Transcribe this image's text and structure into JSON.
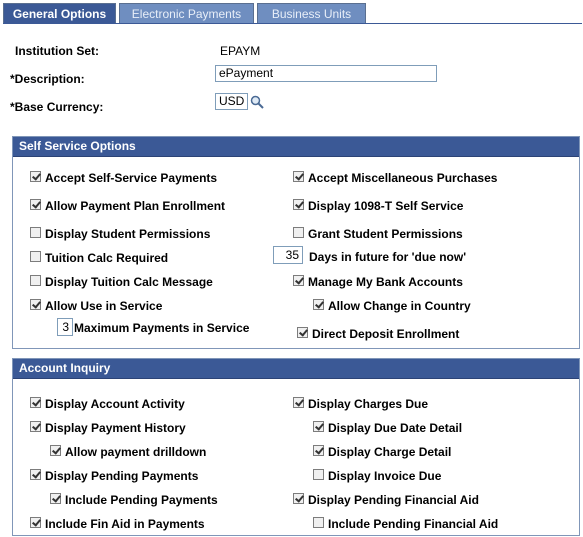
{
  "tabs": [
    {
      "label": "General Options",
      "active": true
    },
    {
      "label": "Electronic Payments",
      "active": false
    },
    {
      "label": "Business Units",
      "active": false
    }
  ],
  "header": {
    "institution_set_label": "Institution Set:",
    "institution_set_value": "EPAYM",
    "description_label": "*Description:",
    "description_value": "ePayment",
    "base_currency_label": "*Base Currency:",
    "base_currency_value": "USD",
    "lookup_icon": "magnifier-icon"
  },
  "self_service": {
    "title": "Self Service Options",
    "left": [
      {
        "label": "Accept Self-Service Payments",
        "checked": true
      },
      {
        "label": "Allow Payment Plan Enrollment",
        "checked": true
      },
      {
        "label": "Display Student Permissions",
        "checked": false
      },
      {
        "label": "Tuition Calc Required",
        "checked": false
      },
      {
        "label": "Display Tuition Calc Message",
        "checked": false
      },
      {
        "label": "Allow Use in Service",
        "checked": true
      }
    ],
    "max_payments_value": "3",
    "max_payments_label": "Maximum Payments in Service",
    "right": [
      {
        "label": "Accept Miscellaneous Purchases",
        "checked": true
      },
      {
        "label": "Display 1098-T Self Service",
        "checked": true
      },
      {
        "label": "Grant Student Permissions",
        "checked": false
      }
    ],
    "days_future_value": "35",
    "days_future_label": "Days in future for 'due now'",
    "manage_bank": {
      "label": "Manage My Bank Accounts",
      "checked": true
    },
    "allow_change_country": {
      "label": "Allow Change in Country",
      "checked": true
    },
    "direct_deposit": {
      "label": "Direct Deposit Enrollment",
      "checked": true
    }
  },
  "account_inquiry": {
    "title": "Account Inquiry",
    "display_account_activity": {
      "label": "Display Account Activity",
      "checked": true
    },
    "display_payment_history": {
      "label": "Display Payment History",
      "checked": true
    },
    "allow_payment_drilldown": {
      "label": "Allow payment drilldown",
      "checked": true
    },
    "display_pending_payments": {
      "label": "Display Pending Payments",
      "checked": true
    },
    "include_pending_payments": {
      "label": "Include Pending Payments",
      "checked": true
    },
    "include_fin_aid": {
      "label": "Include Fin Aid in Payments",
      "checked": true
    },
    "display_charges_due": {
      "label": "Display Charges Due",
      "checked": true
    },
    "display_due_date_detail": {
      "label": "Display Due Date Detail",
      "checked": true
    },
    "display_charge_detail": {
      "label": "Display Charge Detail",
      "checked": true
    },
    "display_invoice_due": {
      "label": "Display Invoice Due",
      "checked": false
    },
    "display_pending_fin_aid": {
      "label": "Display Pending Financial Aid",
      "checked": true
    },
    "include_pending_fin_aid": {
      "label": "Include Pending Financial Aid",
      "checked": false
    }
  }
}
